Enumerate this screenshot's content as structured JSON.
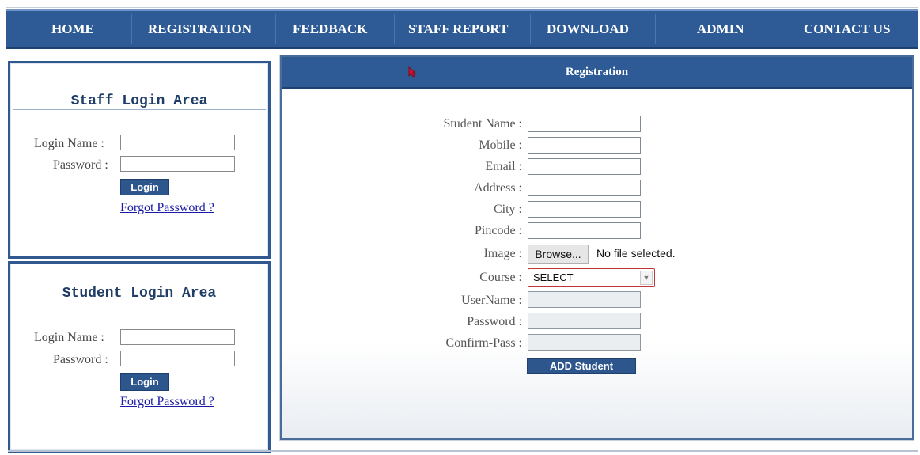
{
  "nav": {
    "items": [
      "HOME",
      "REGISTRATION",
      "FEEDBACK",
      "STAFF REPORT",
      "DOWNLOAD",
      "ADMIN",
      "CONTACT US"
    ]
  },
  "staff_login": {
    "title": "Staff Login Area",
    "login_name_label": "Login Name :",
    "password_label": "Password :",
    "login_value": "",
    "password_value": "",
    "login_button": "Login",
    "forgot_link": "Forgot Password ?"
  },
  "student_login": {
    "title": "Student Login Area",
    "login_name_label": "Login Name :",
    "password_label": "Password :",
    "login_value": "",
    "password_value": "",
    "login_button": "Login",
    "forgot_link": "Forgot Password ?"
  },
  "registration": {
    "header": "Registration",
    "fields": {
      "student_name": "Student Name :",
      "mobile": "Mobile :",
      "email": "Email :",
      "address": "Address :",
      "city": "City :",
      "pincode": "Pincode :",
      "image": "Image :",
      "course": "Course :",
      "username": "UserName :",
      "password": "Password :",
      "confirm_pass": "Confirm-Pass :"
    },
    "browse_button": "Browse...",
    "file_status": "No file selected.",
    "course_selected": "SELECT",
    "add_button": "ADD Student"
  },
  "colors": {
    "nav_bg": "#2e5b96",
    "button_bg": "#2d568d",
    "select_border": "#c0353a",
    "link": "#1a1aa6"
  }
}
